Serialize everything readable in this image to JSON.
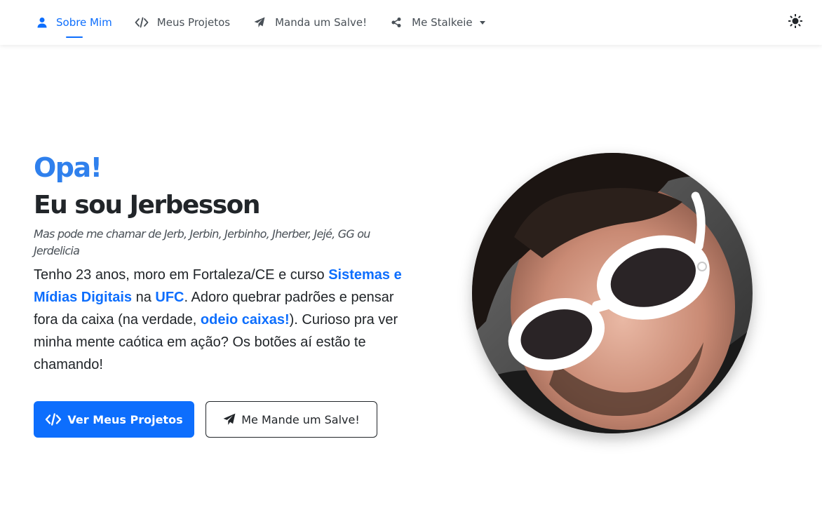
{
  "nav": {
    "items": [
      {
        "label": "Sobre Mim",
        "icon": "user-icon",
        "active": true
      },
      {
        "label": "Meus Projetos",
        "icon": "code-icon",
        "active": false
      },
      {
        "label": "Manda um Salve!",
        "icon": "paper-plane-icon",
        "active": false
      },
      {
        "label": "Me Stalkeie",
        "icon": "share-icon",
        "active": false,
        "dropdown": true
      }
    ],
    "theme_toggle_icon": "sun-icon"
  },
  "hero": {
    "greeting": "Opa!",
    "name": "Eu sou Jerbesson",
    "nicknames": "Mas pode me chamar de Jerb, Jerbin, Jerbinho, Jherber, Jejé, GG ou Jerdelicia",
    "bio": {
      "p1": "Tenho 23 anos, moro em Fortaleza/CE e curso ",
      "course": "Sistemas e Mídias Digitais",
      "p2": " na ",
      "university": "UFC",
      "p3": ". Adoro quebrar padrões e pensar fora da caixa (na verdade, ",
      "emphasis": "odeio caixas!",
      "p4": "). Curioso pra ver minha mente caótica em ação? Os botões aí estão te chamando!"
    },
    "buttons": {
      "primary": {
        "label": "Ver Meus Projetos",
        "icon": "code-icon"
      },
      "secondary": {
        "label": "Me Mande um Salve!",
        "icon": "paper-plane-icon"
      }
    },
    "photo_alt": "profile-photo"
  },
  "colors": {
    "accent": "#0d6efd",
    "greeting": "#2f80ed",
    "text": "#212529"
  }
}
